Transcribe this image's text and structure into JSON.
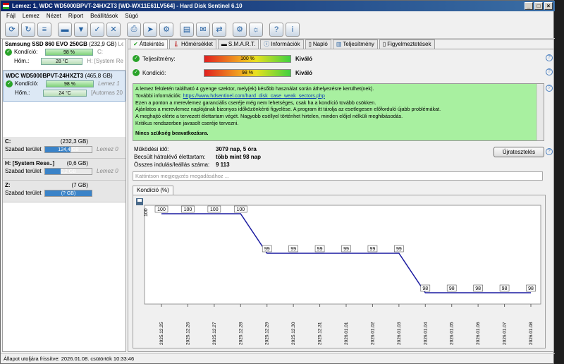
{
  "window": {
    "title": "Lemez: 1, WDC WD5000BPVT-24HXZT3 [WD-WX11E61LV564] - Hard Disk Sentinel 6.10"
  },
  "menu": [
    "Fájl",
    "Lemez",
    "Nézet",
    "Riport",
    "Beállítások",
    "Súgó"
  ],
  "toolbar_icons": [
    "refresh-icon",
    "refresh-all-icon",
    "list-icon",
    "disk-icon",
    "disk-down-icon",
    "disk-check-icon",
    "disk-remove-icon",
    "print-icon",
    "send-icon",
    "settings-icon",
    "report-icon",
    "mail-icon",
    "network-icon",
    "gear-icon",
    "options-icon",
    "help-icon",
    "info-icon"
  ],
  "disks": [
    {
      "name": "Samsung SSD 860 EVO 250GB",
      "size": "(232,9 GB)",
      "suffix": "Le",
      "cond_label": "Kondíció:",
      "cond": "98 %",
      "cond_extra": "C:",
      "temp_label": "Hőm.:",
      "temp": "28 °C",
      "temp_extra": "H: [System Re"
    },
    {
      "name": "WDC WD5000BPVT-24HXZT3",
      "size": "(465,8 GB)",
      "suffix": "",
      "cond_label": "Kondíció:",
      "cond": "98 %",
      "cond_extra": "Lemez 1",
      "temp_label": "Hőm.:",
      "temp": "24 °C",
      "temp_extra": "[Automas 20"
    }
  ],
  "volumes": [
    {
      "name": "C:",
      "size": "(232,3 GB)",
      "free_label": "Szabad terület",
      "free": "124,4 GB",
      "fill": 0.54,
      "disk": "Lemez 0"
    },
    {
      "name": "H: [System Rese..]",
      "size": "(0,6 GB)",
      "free_label": "Szabad terület",
      "free": "0,2 GB",
      "fill": 0.33,
      "disk": "Lemez 0"
    },
    {
      "name": "Z:",
      "size": "(7 GB)",
      "free_label": "Szabad terület",
      "free": "(? GB)",
      "fill": 1.0,
      "disk": ""
    }
  ],
  "tabs": [
    "Áttekintés",
    "Hőmérséklet",
    "S.M.A.R.T.",
    "Információk",
    "Napló",
    "Teljesítmény",
    "Figyelmeztetések"
  ],
  "performance": {
    "label": "Teljesítmény:",
    "value": "100 %",
    "status": "Kiváló",
    "level": 1.0
  },
  "condition": {
    "label": "Kondíció:",
    "value": "98 %",
    "status": "Kiváló",
    "level": 0.98
  },
  "message": {
    "lines": [
      "A lemez felületén található 4 gyenge szektor, mely(ek) később használat során áthelyezésre kerülhet(nek).",
      "További információk: ",
      "Ezen a ponton a merevlemez garanciális cseréje még nem lehetséges, csak ha a kondíció tovább csökken.",
      "Ajánlatos a merevlemez naplójának bizonyos időközönkénti figyelése. A program itt tárolja az esetlegesen előforduló újabb problémákat.",
      "A meghajtó elérte a tervezett élettartam végét. Nagyobb eséllyel történhet hirtelen, minden előjel nélküli meghibásodás.",
      "Kritikus rendszerben javasolt cseréje tervezni."
    ],
    "link": "https://www.hdsentinel.com/hard_disk_case_weak_sectors.php",
    "verdict": "Nincs szükség beavatkozásra."
  },
  "stats": [
    {
      "k": "Működési idő:",
      "v": "3079 nap, 5 óra"
    },
    {
      "k": "Becsült hátralévő élettartam:",
      "v": "több mint 98 nap"
    },
    {
      "k": "Összes indulás/leállás száma:",
      "v": "9 113"
    }
  ],
  "retest_label": "Újratesztelés",
  "note_placeholder": "Kattintson megjegyzés megadásához ...",
  "chart_tab": "Kondíció  (%)",
  "status_bar": "Állapot utoljára frissítve: 2026.01.08. csütörtök 10:33:46",
  "chart_data": {
    "type": "line",
    "x": [
      "2025.12.25",
      "2025.12.26",
      "2025.12.27",
      "2025.12.28",
      "2025.12.29",
      "2025.12.30",
      "2025.12.31",
      "2026.01.01",
      "2026.01.02",
      "2026.01.03",
      "2026.01.04",
      "2026.01.05",
      "2026.01.06",
      "2026.01.07",
      "2026.01.08"
    ],
    "values": [
      100,
      100,
      100,
      100,
      99,
      99,
      99,
      99,
      99,
      99,
      98,
      98,
      98,
      98,
      98
    ],
    "ylabel_tick": "100",
    "color": "#1a1aa0"
  }
}
